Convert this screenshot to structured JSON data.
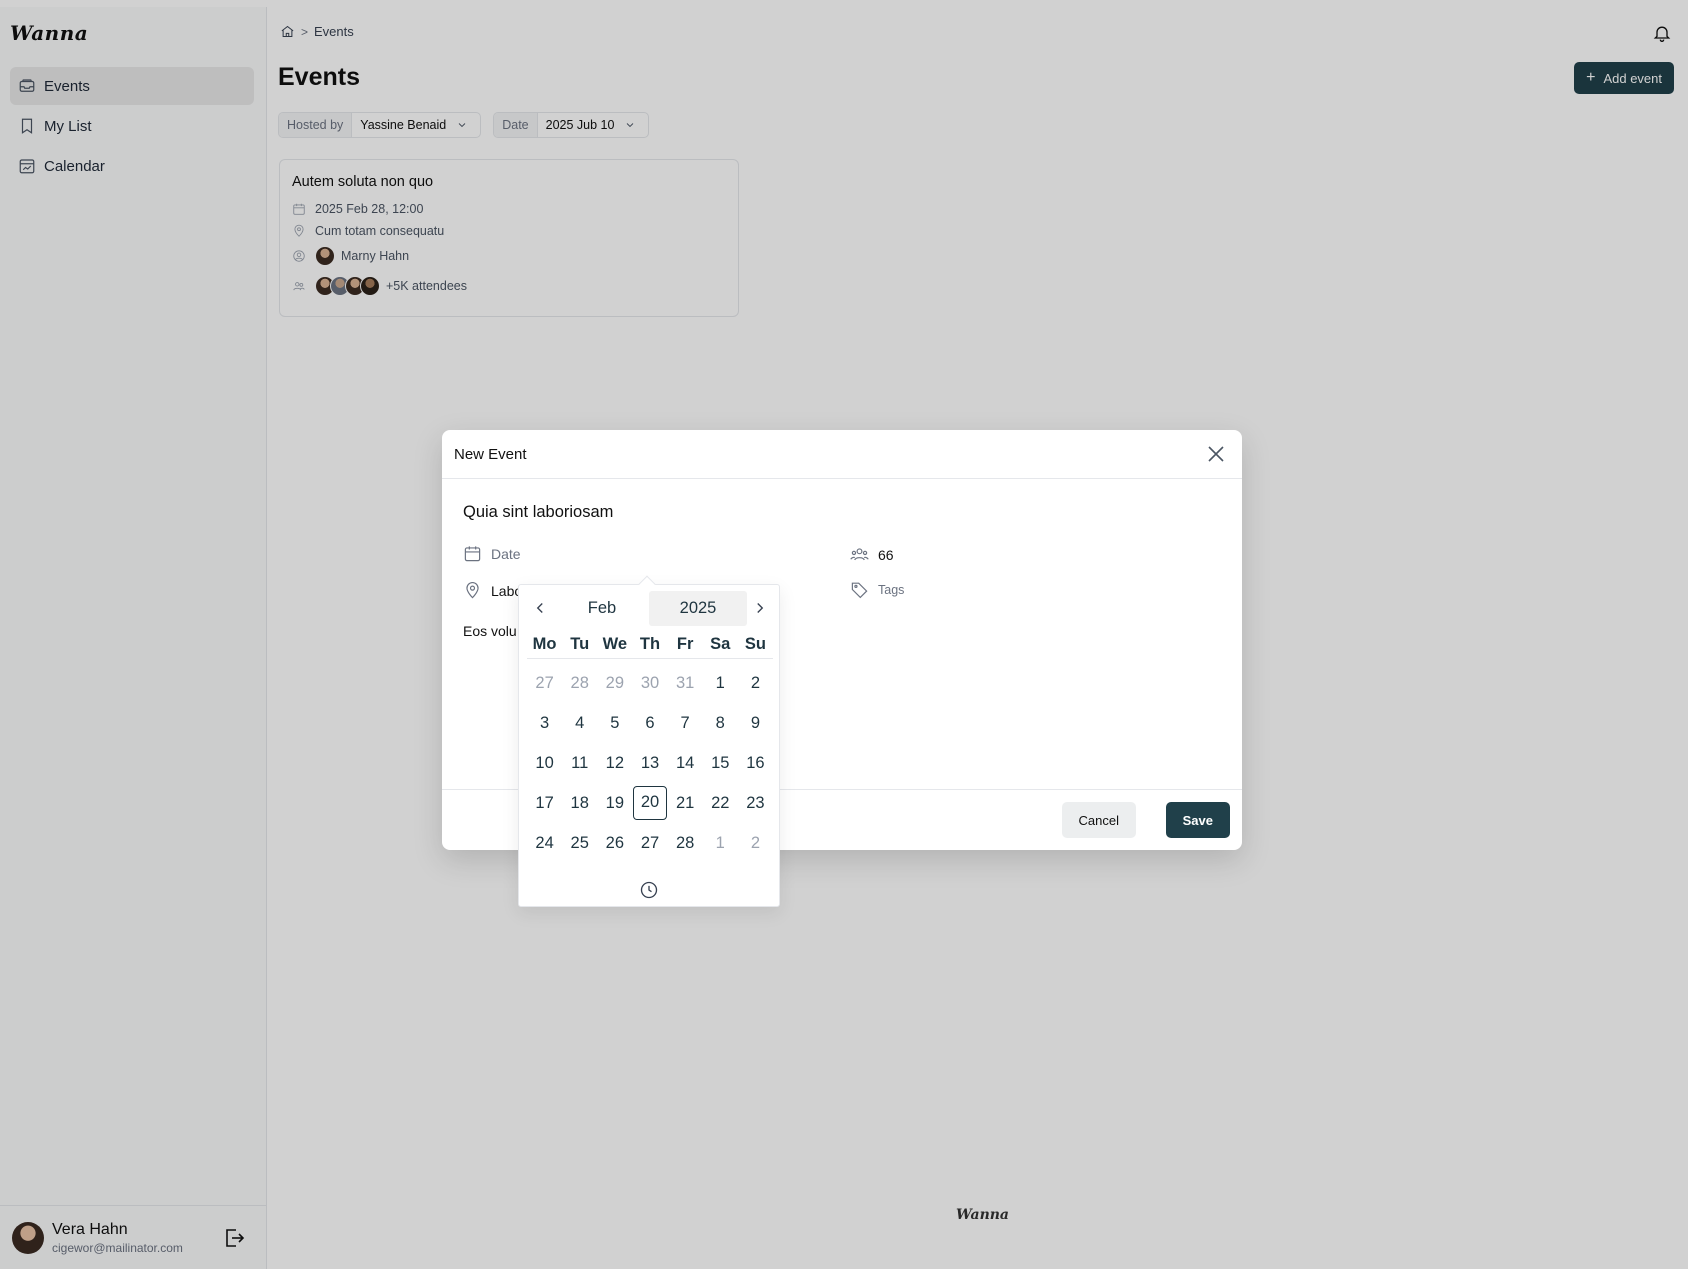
{
  "app": {
    "logo": "Wanna",
    "footer_logo": "Wanna"
  },
  "sidebar": {
    "items": [
      {
        "label": "Events",
        "icon": "inbox-icon",
        "active": true
      },
      {
        "label": "My List",
        "icon": "bookmark-icon",
        "active": false
      },
      {
        "label": "Calendar",
        "icon": "calendar-chart-icon",
        "active": false
      }
    ],
    "user": {
      "name": "Vera Hahn",
      "email": "cigewor@mailinator.com"
    }
  },
  "header": {
    "breadcrumb": [
      "Events"
    ],
    "title": "Events",
    "add_button": "Add event"
  },
  "filters": {
    "hosted_by": {
      "label": "Hosted by",
      "value": "Yassine Benaid"
    },
    "date": {
      "label": "Date",
      "value": "2025 Jub 10"
    }
  },
  "event_card": {
    "title": "Autem soluta non quo",
    "datetime": "2025 Feb 28, 12:00",
    "location": "Cum totam consequatu",
    "host": "Marny Hahn",
    "attendees": "+5K attendees"
  },
  "modal": {
    "title": "New Event",
    "event_name": "Quia sint laboriosam",
    "date_placeholder": "Date",
    "location_value": "Labo",
    "description_value": "Eos volu",
    "capacity": "66",
    "tags_placeholder": "Tags",
    "cancel": "Cancel",
    "save": "Save"
  },
  "datepicker": {
    "month": "Feb",
    "year": "2025",
    "weekdays": [
      "Mo",
      "Tu",
      "We",
      "Th",
      "Fr",
      "Sa",
      "Su"
    ],
    "weeks": [
      [
        {
          "d": "27",
          "m": true
        },
        {
          "d": "28",
          "m": true
        },
        {
          "d": "29",
          "m": true
        },
        {
          "d": "30",
          "m": true
        },
        {
          "d": "31",
          "m": true
        },
        {
          "d": "1"
        },
        {
          "d": "2"
        }
      ],
      [
        {
          "d": "3"
        },
        {
          "d": "4"
        },
        {
          "d": "5"
        },
        {
          "d": "6"
        },
        {
          "d": "7"
        },
        {
          "d": "8"
        },
        {
          "d": "9"
        }
      ],
      [
        {
          "d": "10"
        },
        {
          "d": "11"
        },
        {
          "d": "12"
        },
        {
          "d": "13"
        },
        {
          "d": "14"
        },
        {
          "d": "15"
        },
        {
          "d": "16"
        }
      ],
      [
        {
          "d": "17"
        },
        {
          "d": "18"
        },
        {
          "d": "19"
        },
        {
          "d": "20",
          "s": true
        },
        {
          "d": "21"
        },
        {
          "d": "22"
        },
        {
          "d": "23"
        }
      ],
      [
        {
          "d": "24"
        },
        {
          "d": "25"
        },
        {
          "d": "26"
        },
        {
          "d": "27"
        },
        {
          "d": "28"
        },
        {
          "d": "1",
          "m": true
        },
        {
          "d": "2",
          "m": true
        }
      ]
    ]
  },
  "colors": {
    "primary": "#20404a",
    "text": "#1f3540"
  }
}
